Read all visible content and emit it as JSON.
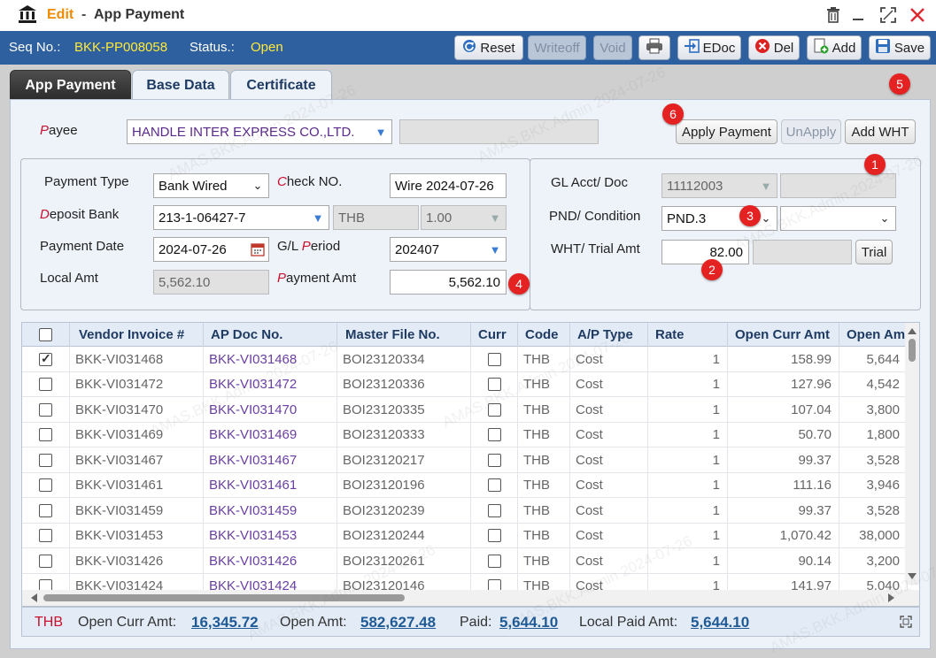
{
  "titlebar": {
    "mode": "Edit",
    "separator": "-",
    "title": "App Payment"
  },
  "status": {
    "seq_label": "Seq No.:",
    "seq_value": "BKK-PP008058",
    "status_label": "Status.:",
    "status_value": "Open"
  },
  "toolbar": {
    "reset": "Reset",
    "writeoff": "Writeoff",
    "void": "Void",
    "edoc": "EDoc",
    "del": "Del",
    "add": "Add",
    "save": "Save"
  },
  "tabs": [
    "App Payment",
    "Base Data",
    "Certificate"
  ],
  "payee": {
    "label_accent": "P",
    "label_rest": "ayee",
    "value": "HANDLE INTER EXPRESS CO.,LTD."
  },
  "buttons": {
    "apply_payment": "Apply Payment",
    "unapply": "UnApply",
    "add_wht": "Add WHT",
    "trial": "Trial"
  },
  "form": {
    "payment_type_label": "Payment Type",
    "payment_type_value": "Bank Wired",
    "check_no_label_accent": "C",
    "check_no_label_rest": "heck NO.",
    "check_no_value": "Wire 2024-07-26",
    "deposit_bank_label_accent": "D",
    "deposit_bank_label_rest": "eposit Bank",
    "deposit_bank_value": "213-1-06427-7",
    "currency_value": "THB",
    "rate_value": "1.00",
    "payment_date_label": "Payment Date",
    "payment_date_value": "2024-07-26",
    "gl_period_label_pre": "G/L ",
    "gl_period_label_accent": "P",
    "gl_period_label_rest": "eriod",
    "gl_period_value": "202407",
    "local_amt_label": "Local Amt",
    "local_amt_value": "5,562.10",
    "payment_amt_label_accent": "P",
    "payment_amt_label_rest": "ayment Amt",
    "payment_amt_value": "5,562.10",
    "gl_acct_label": "GL Acct/ Doc",
    "gl_acct_value": "11112003",
    "pnd_label": "PND/  Condition",
    "pnd_value": "PND.3",
    "wht_label": "WHT/ Trial Amt",
    "wht_value": "82.00"
  },
  "markers": [
    "1",
    "2",
    "3",
    "4",
    "5",
    "6"
  ],
  "grid": {
    "columns": [
      "Vendor Invoice #",
      "AP Doc No.",
      "Master File No.",
      "Curr",
      "Code",
      "A/P Type",
      "Rate",
      "Open Curr Amt",
      "Open Am"
    ],
    "rows": [
      {
        "checked": true,
        "invoice": "BKK-VI031468",
        "ap_doc": "BKK-VI031468",
        "master": "BOI23120334",
        "code": "THB",
        "type": "Cost",
        "rate": "1",
        "open_curr": "158.99",
        "open_amt": "5,644"
      },
      {
        "checked": false,
        "invoice": "BKK-VI031472",
        "ap_doc": "BKK-VI031472",
        "master": "BOI23120336",
        "code": "THB",
        "type": "Cost",
        "rate": "1",
        "open_curr": "127.96",
        "open_amt": "4,542"
      },
      {
        "checked": false,
        "invoice": "BKK-VI031470",
        "ap_doc": "BKK-VI031470",
        "master": "BOI23120335",
        "code": "THB",
        "type": "Cost",
        "rate": "1",
        "open_curr": "107.04",
        "open_amt": "3,800"
      },
      {
        "checked": false,
        "invoice": "BKK-VI031469",
        "ap_doc": "BKK-VI031469",
        "master": "BOI23120333",
        "code": "THB",
        "type": "Cost",
        "rate": "1",
        "open_curr": "50.70",
        "open_amt": "1,800"
      },
      {
        "checked": false,
        "invoice": "BKK-VI031467",
        "ap_doc": "BKK-VI031467",
        "master": "BOI23120217",
        "code": "THB",
        "type": "Cost",
        "rate": "1",
        "open_curr": "99.37",
        "open_amt": "3,528"
      },
      {
        "checked": false,
        "invoice": "BKK-VI031461",
        "ap_doc": "BKK-VI031461",
        "master": "BOI23120196",
        "code": "THB",
        "type": "Cost",
        "rate": "1",
        "open_curr": "111.16",
        "open_amt": "3,946"
      },
      {
        "checked": false,
        "invoice": "BKK-VI031459",
        "ap_doc": "BKK-VI031459",
        "master": "BOI23120239",
        "code": "THB",
        "type": "Cost",
        "rate": "1",
        "open_curr": "99.37",
        "open_amt": "3,528"
      },
      {
        "checked": false,
        "invoice": "BKK-VI031453",
        "ap_doc": "BKK-VI031453",
        "master": "BOI23120244",
        "code": "THB",
        "type": "Cost",
        "rate": "1",
        "open_curr": "1,070.42",
        "open_amt": "38,000"
      },
      {
        "checked": false,
        "invoice": "BKK-VI031426",
        "ap_doc": "BKK-VI031426",
        "master": "BOI23120261",
        "code": "THB",
        "type": "Cost",
        "rate": "1",
        "open_curr": "90.14",
        "open_amt": "3,200"
      },
      {
        "checked": false,
        "invoice": "BKK-VI031424",
        "ap_doc": "BKK-VI031424",
        "master": "BOI23120146",
        "code": "THB",
        "type": "Cost",
        "rate": "1",
        "open_curr": "141.97",
        "open_amt": "5,040"
      }
    ]
  },
  "footer": {
    "currency": "THB",
    "open_curr_label": "Open Curr Amt:",
    "open_curr_value": "16,345.72",
    "open_amt_label": "Open Amt:",
    "open_amt_value": "582,627.48",
    "paid_label": "Paid:",
    "paid_value": "5,644.10",
    "local_paid_label": "Local Paid Amt:",
    "local_paid_value": "5,644.10"
  },
  "watermark_text": "AMAS.BKK.Admin 2024-07-26",
  "colors": {
    "status_bar": "#2e5f9e",
    "status_value": "#ffea3a",
    "mode_text": "#f08a00",
    "required_label": "#c8102e",
    "marker": "#e52222",
    "link": "#6a3fa3"
  }
}
